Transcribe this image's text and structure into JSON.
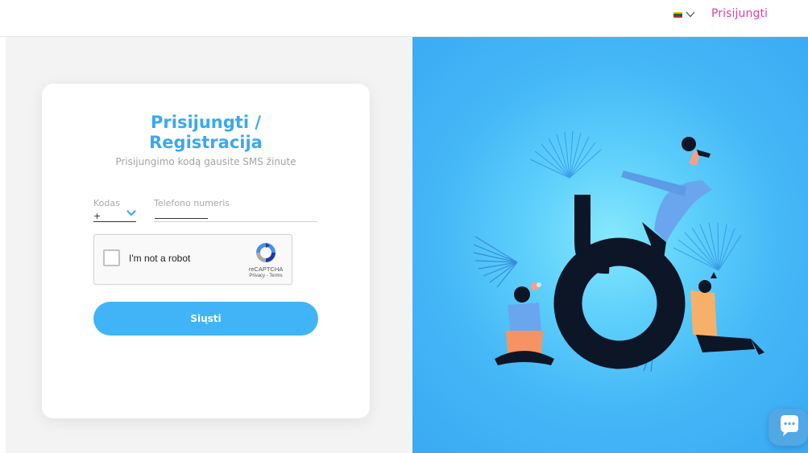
{
  "header": {
    "language_flag": {
      "colors": [
        "#FDB913",
        "#006A44",
        "#C1272D"
      ]
    },
    "language_chevron_icon": "chevron-down-icon",
    "login_link": "Prisijungti"
  },
  "card": {
    "title_line1": "Prisijungti /",
    "title_line2": "Registracija",
    "subtitle": "Prisijungimo kodą gausite SMS žinute",
    "code_label": "Kodas",
    "code_value": "+",
    "phone_label": "Telefono numeris",
    "recaptcha": {
      "checkbox_label": "I'm not a robot",
      "brand": "reCAPTCHA",
      "links": "Privacy - Terms"
    },
    "submit_label": "Siųsti"
  },
  "chat": {
    "icon": "chat-bubble-icon"
  },
  "colors": {
    "brand_pink": "#e0409f",
    "accent_blue": "#40b4f7",
    "title_blue": "#3aa8ef"
  }
}
